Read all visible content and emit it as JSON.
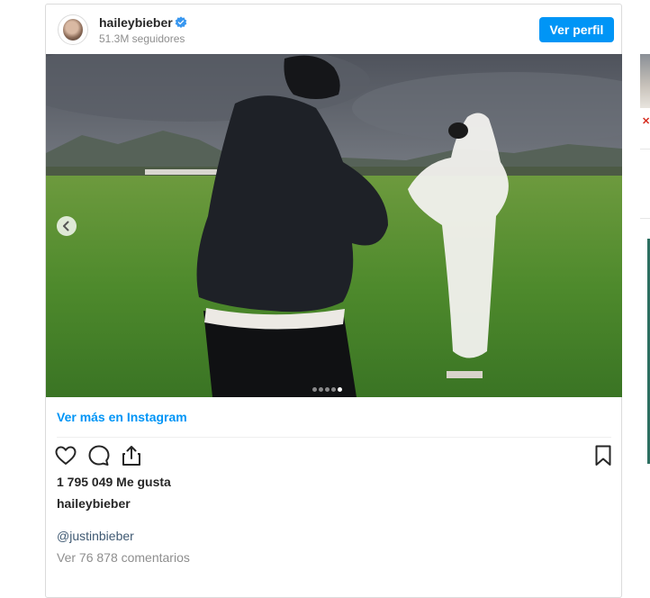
{
  "post": {
    "username": "haileybieber",
    "followers": "51.3M seguidores",
    "view_profile_label": "Ver perfil",
    "see_more_label": "Ver más en Instagram",
    "likes": "1 795 049 Me gusta",
    "caption_user": "haileybieber",
    "caption_mention": "@justinbieber",
    "view_comments": "Ver 76 878 comentarios",
    "carousel": {
      "total_slides": 5,
      "active_slide": 5
    }
  },
  "colors": {
    "accent": "#0095f6",
    "verified": "#3897f0",
    "mention": "#405a73",
    "muted": "#8e8e8e"
  },
  "icons": {
    "verified": "verified-badge-icon",
    "like": "heart-icon",
    "comment": "comment-bubble-icon",
    "share": "share-icon",
    "save": "bookmark-icon",
    "prev": "chevron-left-icon"
  }
}
